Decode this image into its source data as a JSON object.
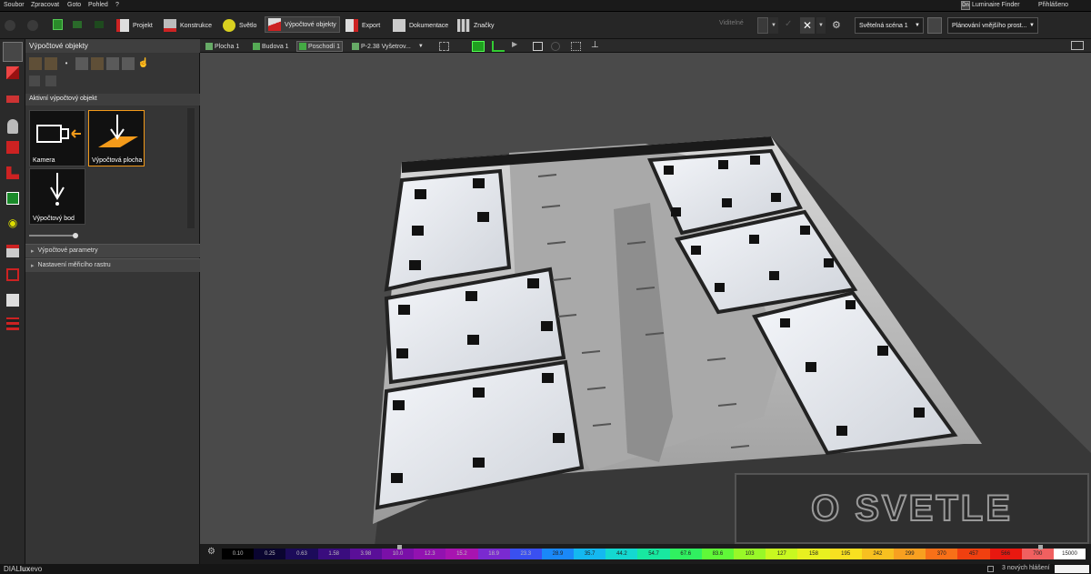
{
  "menu": {
    "items": [
      "Soubor",
      "Zpracovat",
      "Goto",
      "Pohled",
      "?"
    ],
    "luminaire_finder": "Luminaire Finder",
    "login": "Přihlášeno"
  },
  "toolbar": {
    "tabs": [
      "Projekt",
      "Konstrukce",
      "Světlo",
      "Výpočtové objekty",
      "Export",
      "Dokumentace",
      "Značky"
    ],
    "scene_select": "Světelná scéna 1",
    "view_select": "Plánování vnějšího prost...",
    "visible_label": "Viditelné"
  },
  "panel": {
    "title": "Výpočtové objekty",
    "active_header": "Aktivní výpočtový objekt",
    "tiles": [
      "Kamera",
      "Výpočtová plocha",
      "Výpočtový bod"
    ],
    "sections": [
      "Výpočtové parametry",
      "Nastavení měřicího rastru"
    ]
  },
  "viewtabs": [
    "Plocha 1",
    "Budova 1",
    "Poschodí 1",
    "P-2.38 Vyšetrov..."
  ],
  "scale": {
    "values": [
      "0.10",
      "0.25",
      "0.63",
      "1.58",
      "3.98",
      "10.0",
      "12.3",
      "15.2",
      "18.9",
      "23.3",
      "28.9",
      "35.7",
      "44.2",
      "54.7",
      "67.6",
      "83.6",
      "103",
      "127",
      "158",
      "195",
      "242",
      "299",
      "370",
      "457",
      "566",
      "700",
      "15000"
    ],
    "colors": [
      "#000000",
      "#0a0530",
      "#1c0b5a",
      "#3a0d7e",
      "#5a0f98",
      "#7a10a8",
      "#9212b0",
      "#a814b0",
      "#7a2ad0",
      "#3a50f0",
      "#1a88f8",
      "#14b8f0",
      "#14d8d0",
      "#18e8a0",
      "#30f060",
      "#60f838",
      "#98f828",
      "#c8f820",
      "#e8f020",
      "#f8e020",
      "#f8c020",
      "#f8a020",
      "#f87018",
      "#f04010",
      "#e81810",
      "#f06060",
      "#ffffff"
    ]
  },
  "status": {
    "reports": "3 nových hlášení"
  },
  "brand": {
    "dial": "DIAL",
    "lux": "lux",
    "evo": "evo"
  },
  "watermark": "O SVETLE"
}
